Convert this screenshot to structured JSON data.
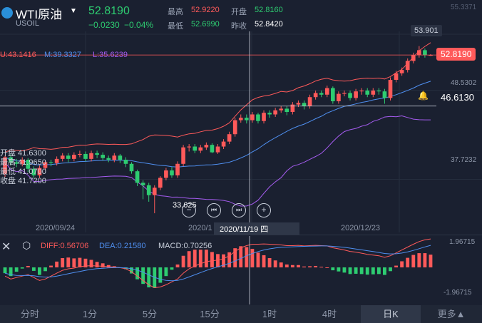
{
  "header": {
    "symbol": "WTI原油",
    "code": "USOIL",
    "price": "52.8190",
    "change": "−0.0230",
    "change_pct": "−0.04%",
    "high_label": "最高",
    "high": "52.9220",
    "open_label": "开盘",
    "open": "52.8160",
    "low_label": "最低",
    "low": "52.6990",
    "prev_close_label": "昨收",
    "prev_close": "52.8420"
  },
  "indicators": {
    "boll_u": "U:43.1416",
    "boll_m": "M:39.3327",
    "boll_l": "L:35.6239",
    "diff": "DIFF:0.56706",
    "dea": "DEA:0.21580",
    "macd": "MACD:0.70256"
  },
  "axis": {
    "y_top": "55.3371",
    "y_mid1": "48.5302",
    "y_mid2": "37.7232",
    "macd_top": "1.96715",
    "macd_bottom": "-1.96715",
    "x_ticks": [
      "2020/09/24",
      "2020/1",
      "2020/12/23"
    ],
    "crosshair_date": "2020/11/19 四"
  },
  "tags": {
    "max_label": "53.901",
    "current_price": "52.8190",
    "cursor_price": "46.6130",
    "min_label": "33.625"
  },
  "ohlc_box": {
    "open": "开盘 41.6300",
    "high": "最高 41.9650",
    "low": "最低 41.0700",
    "close": "收盘 41.7200"
  },
  "tabs": [
    "分时",
    "1分",
    "5分",
    "15分",
    "1时",
    "4时",
    "日K",
    "更多▲"
  ],
  "active_tab": "日K",
  "colors": {
    "up": "#ff5a5a",
    "down": "#2ecc71",
    "bg": "#1a2030",
    "boll_u": "#ff5a5a",
    "boll_m": "#4f8ff0",
    "boll_l": "#a55cf0"
  },
  "chart_data": {
    "type": "candlestick",
    "ylim": [
      33.0,
      55.34
    ],
    "candles": [
      [
        38.4,
        40.4,
        38.0,
        40.6
      ],
      [
        40.4,
        39.8,
        39.4,
        40.8
      ],
      [
        39.8,
        39.6,
        39.2,
        40.2
      ],
      [
        39.6,
        40.1,
        39.3,
        40.4
      ],
      [
        40.1,
        39.0,
        38.6,
        40.3
      ],
      [
        39.0,
        38.2,
        37.9,
        39.3
      ],
      [
        38.2,
        39.1,
        37.9,
        39.4
      ],
      [
        39.1,
        39.8,
        38.8,
        40.1
      ],
      [
        39.8,
        39.7,
        39.3,
        40.1
      ],
      [
        39.7,
        40.2,
        39.4,
        40.5
      ],
      [
        40.2,
        40.6,
        39.9,
        40.9
      ],
      [
        40.6,
        40.2,
        39.8,
        40.9
      ],
      [
        40.2,
        40.7,
        39.9,
        41.0
      ],
      [
        40.7,
        40.8,
        40.4,
        41.2
      ],
      [
        40.8,
        40.2,
        39.9,
        41.1
      ],
      [
        40.2,
        40.9,
        39.9,
        41.2
      ],
      [
        40.9,
        40.7,
        40.3,
        41.2
      ],
      [
        40.7,
        40.3,
        40.0,
        41.0
      ],
      [
        40.3,
        40.1,
        39.8,
        40.6
      ],
      [
        40.1,
        40.6,
        39.8,
        40.9
      ],
      [
        40.6,
        40.1,
        39.7,
        40.8
      ],
      [
        40.1,
        39.6,
        39.2,
        40.4
      ],
      [
        39.6,
        38.7,
        38.4,
        39.8
      ],
      [
        38.7,
        37.3,
        36.9,
        38.9
      ],
      [
        37.3,
        37.0,
        35.3,
        37.6
      ],
      [
        37.0,
        35.8,
        35.0,
        37.3
      ],
      [
        35.8,
        36.7,
        33.6,
        37.0
      ],
      [
        36.7,
        37.9,
        36.4,
        38.1
      ],
      [
        37.9,
        38.8,
        37.6,
        39.1
      ],
      [
        38.8,
        38.2,
        37.9,
        39.2
      ],
      [
        38.2,
        39.6,
        37.9,
        39.9
      ],
      [
        39.6,
        41.6,
        39.3,
        41.9
      ],
      [
        41.6,
        41.7,
        41.1,
        42.0
      ],
      [
        41.7,
        41.2,
        40.9,
        42.0
      ],
      [
        41.2,
        41.6,
        40.9,
        41.9
      ],
      [
        41.6,
        41.9,
        41.3,
        42.2
      ],
      [
        41.9,
        41.0,
        40.9,
        42.1
      ],
      [
        41.0,
        41.7,
        40.8,
        42.0
      ],
      [
        41.7,
        42.3,
        41.4,
        42.6
      ],
      [
        42.3,
        43.2,
        42.0,
        43.5
      ],
      [
        43.2,
        44.9,
        42.9,
        45.2
      ],
      [
        44.9,
        45.2,
        44.6,
        45.6
      ],
      [
        45.2,
        44.9,
        44.5,
        45.6
      ],
      [
        44.9,
        45.6,
        44.6,
        45.9
      ],
      [
        45.6,
        44.8,
        44.5,
        45.8
      ],
      [
        44.8,
        45.8,
        44.5,
        46.1
      ],
      [
        45.8,
        45.6,
        45.2,
        46.1
      ],
      [
        45.6,
        46.1,
        45.3,
        46.4
      ],
      [
        46.1,
        46.3,
        45.8,
        46.6
      ],
      [
        46.3,
        45.9,
        45.5,
        46.6
      ],
      [
        45.9,
        46.8,
        45.6,
        47.1
      ],
      [
        46.8,
        47.0,
        46.5,
        47.3
      ],
      [
        47.0,
        46.6,
        46.2,
        47.3
      ],
      [
        46.6,
        47.7,
        46.3,
        48.0
      ],
      [
        47.7,
        48.2,
        47.4,
        48.5
      ],
      [
        48.2,
        48.0,
        47.7,
        48.5
      ],
      [
        48.0,
        48.8,
        47.7,
        49.1
      ],
      [
        48.8,
        47.2,
        46.9,
        49.0
      ],
      [
        47.2,
        48.1,
        46.9,
        48.4
      ],
      [
        48.1,
        48.2,
        47.8,
        48.5
      ],
      [
        48.2,
        47.6,
        47.3,
        48.5
      ],
      [
        47.6,
        48.4,
        47.3,
        48.7
      ],
      [
        48.4,
        48.5,
        48.0,
        48.8
      ],
      [
        48.5,
        48.0,
        47.7,
        48.8
      ],
      [
        48.0,
        48.5,
        47.7,
        48.8
      ],
      [
        48.5,
        48.4,
        48.0,
        48.8
      ],
      [
        48.4,
        47.6,
        46.9,
        48.7
      ],
      [
        47.6,
        49.8,
        47.3,
        50.1
      ],
      [
        49.8,
        50.6,
        49.5,
        50.9
      ],
      [
        50.6,
        51.0,
        50.3,
        51.3
      ],
      [
        51.0,
        52.1,
        50.7,
        52.4
      ],
      [
        52.1,
        52.8,
        51.8,
        53.1
      ],
      [
        52.8,
        53.4,
        52.5,
        53.9
      ],
      [
        53.4,
        52.8,
        52.5,
        53.6
      ],
      [
        52.8,
        52.82,
        52.7,
        52.92
      ]
    ],
    "diff": [
      -0.6,
      -0.8,
      -0.7,
      -0.6,
      -0.5,
      -0.7,
      -0.9,
      -0.8,
      -0.6,
      -0.4,
      -0.2,
      -0.1,
      -0.05,
      0.05,
      0.1,
      0.12,
      0.1,
      0.08,
      0.05,
      0.02,
      -0.02,
      -0.1,
      -0.3,
      -0.6,
      -0.9,
      -1.2,
      -1.4,
      -1.35,
      -1.2,
      -1.0,
      -0.8,
      -0.4,
      -0.1,
      0.1,
      0.25,
      0.4,
      0.45,
      0.5,
      0.6,
      0.8,
      1.1,
      1.35,
      1.5,
      1.6,
      1.6,
      1.62,
      1.6,
      1.58,
      1.55,
      1.5,
      1.5,
      1.52,
      1.48,
      1.5,
      1.52,
      1.5,
      1.48,
      1.35,
      1.28,
      1.2,
      1.1,
      1.05,
      0.98,
      0.9,
      0.85,
      0.8,
      0.7,
      0.8,
      1.0,
      1.2,
      1.4,
      1.6,
      1.78,
      1.9,
      1.96
    ],
    "dea": [
      -0.4,
      -0.5,
      -0.55,
      -0.56,
      -0.55,
      -0.58,
      -0.64,
      -0.67,
      -0.66,
      -0.6,
      -0.52,
      -0.44,
      -0.36,
      -0.28,
      -0.2,
      -0.14,
      -0.09,
      -0.06,
      -0.03,
      -0.02,
      -0.02,
      -0.04,
      -0.09,
      -0.19,
      -0.33,
      -0.51,
      -0.69,
      -0.82,
      -0.9,
      -0.92,
      -0.9,
      -0.8,
      -0.66,
      -0.51,
      -0.36,
      -0.21,
      -0.08,
      0.04,
      0.15,
      0.28,
      0.44,
      0.62,
      0.8,
      0.96,
      1.09,
      1.2,
      1.28,
      1.34,
      1.38,
      1.4,
      1.42,
      1.44,
      1.45,
      1.46,
      1.47,
      1.48,
      1.48,
      1.45,
      1.42,
      1.38,
      1.33,
      1.27,
      1.21,
      1.15,
      1.09,
      1.03,
      0.96,
      0.93,
      0.94,
      0.99,
      1.07,
      1.17,
      1.29,
      1.41,
      1.52
    ]
  }
}
